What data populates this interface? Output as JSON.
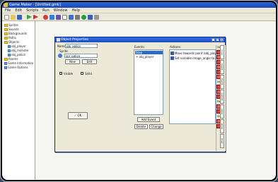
{
  "window": {
    "title": "Game Maker - [Untitled.gmk]"
  },
  "menu": [
    "File",
    "Edit",
    "Scripts",
    "Run",
    "Window",
    "Help"
  ],
  "toolbar": {
    "buttons": [
      "new-icon",
      "open-icon",
      "save-icon",
      "run-icon",
      "debug-icon",
      "sprite-icon",
      "sound-icon",
      "background-icon",
      "path-icon",
      "script-icon",
      "font-icon",
      "object-icon",
      "room-icon",
      "settings-icon"
    ]
  },
  "tree": [
    {
      "label": "Sprites",
      "kind": "folder"
    },
    {
      "label": "Sounds",
      "kind": "folder"
    },
    {
      "label": "Backgrounds",
      "kind": "folder"
    },
    {
      "label": "Paths",
      "kind": "folder"
    },
    {
      "label": "Objects",
      "kind": "folder"
    },
    {
      "label": "obj_player",
      "kind": "file"
    },
    {
      "label": "obj_monster",
      "kind": "file"
    },
    {
      "label": "obj_police",
      "kind": "file"
    },
    {
      "label": "Rooms",
      "kind": "folder"
    },
    {
      "label": "Game Information",
      "kind": "file"
    },
    {
      "label": "Game Options",
      "kind": "file"
    }
  ],
  "dialog": {
    "title": "Object Properties",
    "name_label": "Name:",
    "name_value": "obj_police",
    "sprite_label": "Sprite",
    "sprite_value": "spr_police",
    "new_button": "New",
    "edit_button": "Edit",
    "visible_label": "Visible",
    "solid_label": "Solid",
    "visible_checked": true,
    "solid_checked": false,
    "ok_button": "OK",
    "events_label": "Events:",
    "events": [
      "Step",
      "obj_player"
    ],
    "add_event_button": "Add Event",
    "delete_button": "Delete",
    "change_button": "Change",
    "actions_label": "Actions:",
    "actions": [
      "Move towards point (obj_player.x,o",
      "Set variable image_angle to directi"
    ],
    "library_headings": [
      "Move",
      "Jump",
      "Paths",
      "Steps"
    ],
    "tabs": [
      "move",
      "main1",
      "main2",
      "control",
      "score",
      "extra",
      "draw"
    ]
  }
}
